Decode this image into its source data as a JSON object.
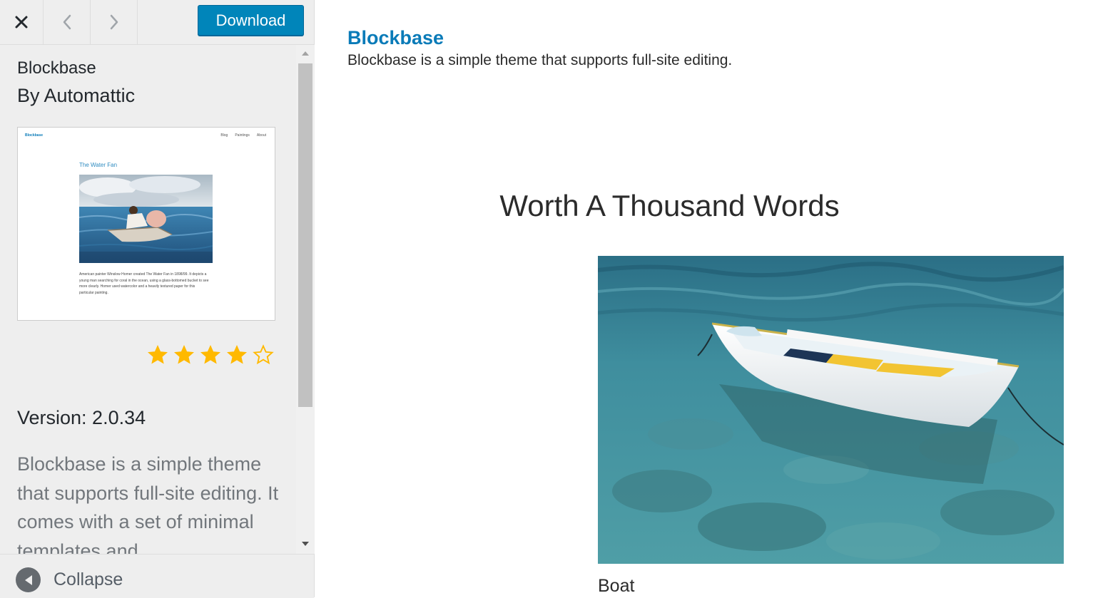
{
  "toolbar": {
    "close_icon": "close-icon",
    "prev_icon": "chevron-left-icon",
    "next_icon": "chevron-right-icon",
    "download_label": "Download",
    "accent_color": "#0085ba"
  },
  "theme": {
    "name": "Blockbase",
    "author": "By Automattic",
    "rating": {
      "value": 4,
      "max": 5,
      "star_color": "#ffb900"
    },
    "version": "Version: 2.0.34",
    "description": "Blockbase is a simple theme that supports full-site editing. It comes with a set of minimal templates and"
  },
  "screenshot": {
    "site_title": "Blockbase",
    "nav": [
      "Blog",
      "Paintings",
      "About"
    ],
    "post_title": "The Water Fan",
    "body_text": "American painter Winslow Homer created The Water Fan in 1898/99. It depicts a young man searching for coral in the ocean, using a glass-bottomed bucket to see more clearly. Homer used watercolor and a heavily textured paper for this particular painting."
  },
  "footer": {
    "collapse_label": "Collapse",
    "collapse_icon": "arrow-left-icon"
  },
  "preview": {
    "site_title": "Blockbase",
    "tagline": "Blockbase is a simple theme that supports full-site editing.",
    "heading": "Worth A Thousand Words",
    "caption": "Boat",
    "title_color": "#0a7bb8"
  }
}
